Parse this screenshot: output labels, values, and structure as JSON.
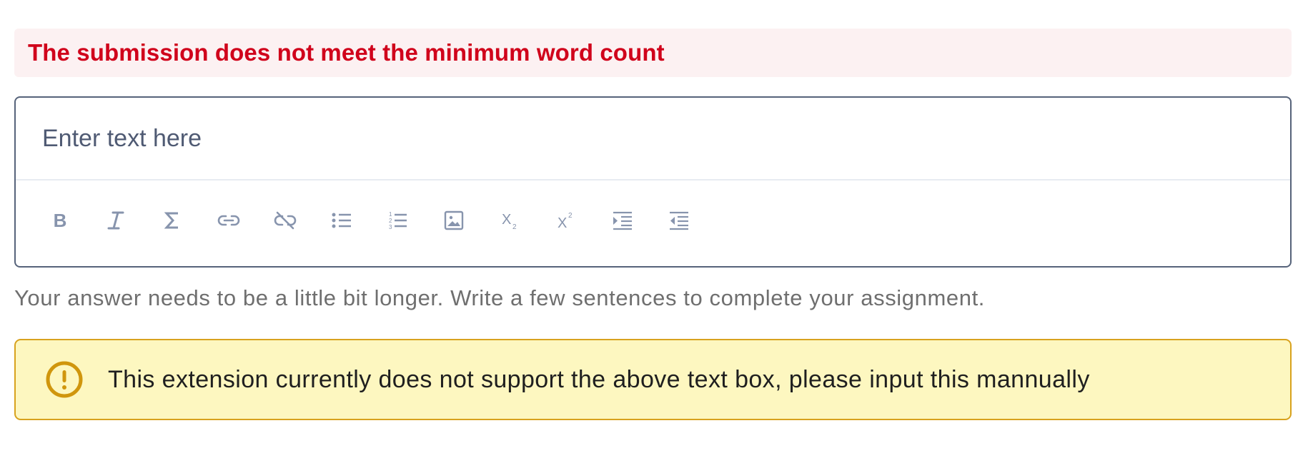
{
  "error": {
    "message": "The submission does not meet the minimum word count"
  },
  "editor": {
    "placeholder": "Enter text here",
    "value": "",
    "toolbar": [
      {
        "id": "bold",
        "icon": "bold-icon",
        "label": "B"
      },
      {
        "id": "italic",
        "icon": "italic-icon",
        "label": "I"
      },
      {
        "id": "formula",
        "icon": "sigma-icon",
        "label": "Σ"
      },
      {
        "id": "link",
        "icon": "link-icon",
        "label": ""
      },
      {
        "id": "unlink",
        "icon": "unlink-icon",
        "label": ""
      },
      {
        "id": "bullet-list",
        "icon": "bullet-list-icon",
        "label": ""
      },
      {
        "id": "numbered-list",
        "icon": "numbered-list-icon",
        "label": ""
      },
      {
        "id": "image",
        "icon": "image-icon",
        "label": ""
      },
      {
        "id": "subscript",
        "icon": "subscript-icon",
        "label": "X₂"
      },
      {
        "id": "superscript",
        "icon": "superscript-icon",
        "label": "X²"
      },
      {
        "id": "indent",
        "icon": "indent-icon",
        "label": ""
      },
      {
        "id": "outdent",
        "icon": "outdent-icon",
        "label": ""
      }
    ]
  },
  "helper": {
    "text": "Your answer needs to be a little bit longer. Write a few sentences to complete your assignment."
  },
  "warning": {
    "icon": "exclamation-circle-icon",
    "text": "This extension currently does not support the above text box, please input this mannually"
  },
  "colors": {
    "error_text": "#d0021b",
    "error_bg": "#fcf1f2",
    "editor_border": "#56637a",
    "toolbar_icon": "#8794ad",
    "warning_bg": "#fdf7c0",
    "warning_border": "#d8a21e"
  }
}
